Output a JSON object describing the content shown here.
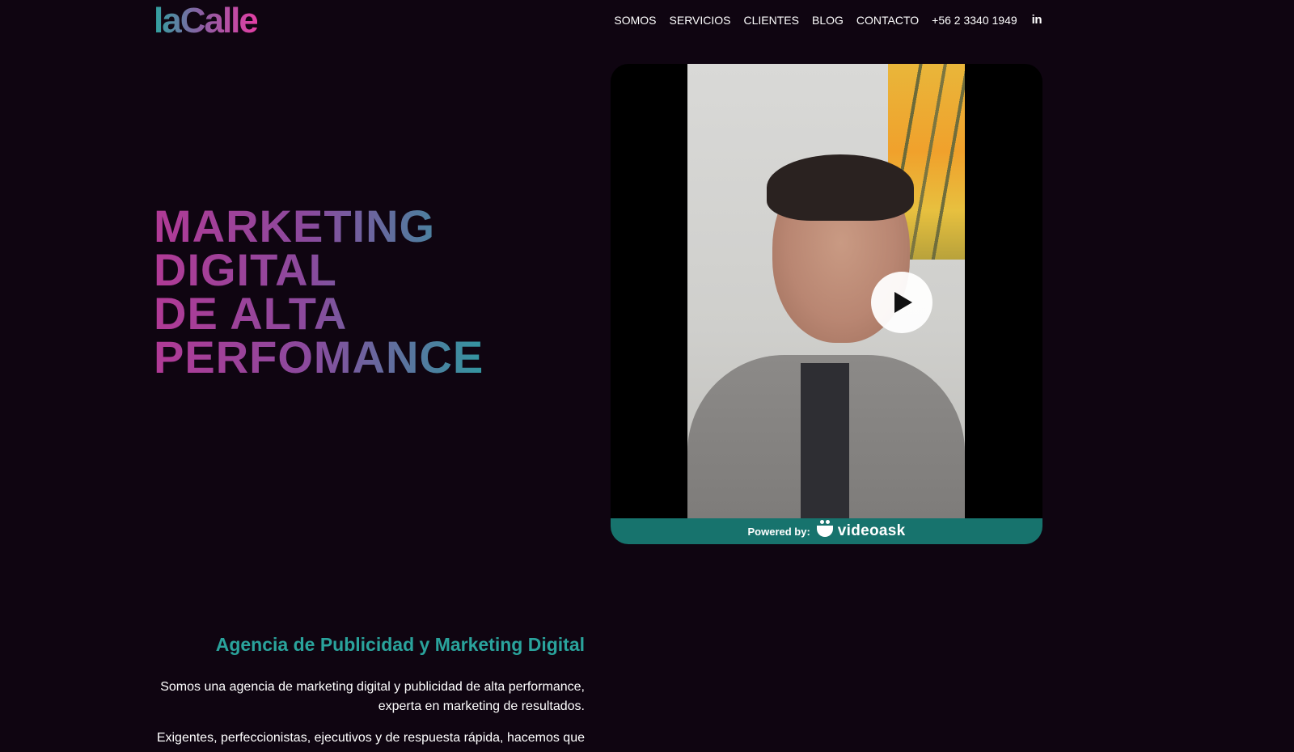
{
  "header": {
    "logo_text": "laCalle",
    "nav": [
      {
        "label": "SOMOS"
      },
      {
        "label": "SERVICIOS"
      },
      {
        "label": "CLIENTES"
      },
      {
        "label": "BLOG"
      },
      {
        "label": "CONTACTO"
      },
      {
        "label": "+56 2 3340 1949"
      }
    ],
    "linkedin_label": "in",
    "linkedin_icon": "linkedin-icon"
  },
  "hero": {
    "headline_lines": [
      "MARKETING",
      "DIGITAL",
      "DE ALTA",
      "PERFOMANCE"
    ],
    "headline_gradient": [
      "#b13a96",
      "#8a4a9d",
      "#2a9ea0"
    ]
  },
  "video": {
    "play_icon": "play-icon",
    "footer_prefix": "Powered by:",
    "footer_brand": "videoask",
    "footer_icon": "videoask-icon",
    "footer_color": "#17736d"
  },
  "about": {
    "title": "Agencia de Publicidad y Marketing Digital",
    "paragraph1_lines": [
      "Somos una agencia de marketing digital y publicidad de alta performance,",
      "experta en marketing de resultados."
    ],
    "paragraph2": "Exigentes, perfeccionistas, ejecutivos y de respuesta rápida, hacemos que",
    "title_color": "#2aa39c"
  },
  "colors": {
    "background": "#0f0511",
    "accent_teal": "#2aa39c",
    "accent_magenta": "#b13a96"
  }
}
